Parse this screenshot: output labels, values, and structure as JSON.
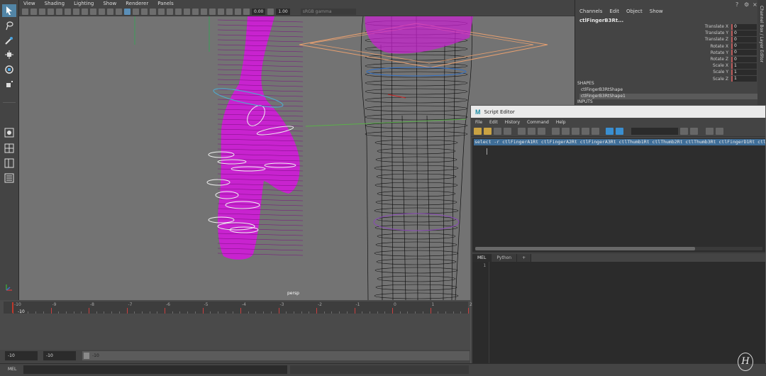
{
  "viewport": {
    "menu": [
      "View",
      "Shading",
      "Lighting",
      "Show",
      "Renderer",
      "Panels"
    ],
    "toolbar": {
      "exposure": "0.00",
      "gamma": "1.00",
      "color_space": "sRGB gamma"
    },
    "camera_label": "persp"
  },
  "channel_box": {
    "menu": [
      "Channels",
      "Edit",
      "Object",
      "Show"
    ],
    "object_name": "ctlFingerB3Rt...",
    "attributes": [
      {
        "label": "Translate X",
        "value": "0"
      },
      {
        "label": "Translate Y",
        "value": "0"
      },
      {
        "label": "Translate Z",
        "value": "0"
      },
      {
        "label": "Rotate X",
        "value": "0"
      },
      {
        "label": "Rotate Y",
        "value": "0"
      },
      {
        "label": "Rotate Z",
        "value": "0"
      },
      {
        "label": "Scale X",
        "value": "1"
      },
      {
        "label": "Scale Y",
        "value": "1"
      },
      {
        "label": "Scale Z",
        "value": "1"
      }
    ],
    "shapes_header": "SHAPES",
    "shapes": [
      "ctlFingerB3RtShape",
      "ctlFingerB3RtShape1"
    ],
    "inputs_header": "INPUTS",
    "side_tab": "Channel Box / Layer Editor"
  },
  "script_editor": {
    "title": "Script Editor",
    "menu": [
      "File",
      "Edit",
      "History",
      "Command",
      "Help"
    ],
    "history_line": "select -r ctlFingerA1Rt ctlFingerA2Rt ctlFingerA3Rt ctlThumb1Rt ctlThumb2Rt ctlThumb3Rt ctlFingerD1Rt ctlFin",
    "tabs": [
      "MEL",
      "Python",
      "+"
    ],
    "line_number": "1"
  },
  "timeline": {
    "ticks": [
      "-10",
      "-9",
      "-8",
      "-7",
      "-6",
      "-5",
      "-4",
      "-3",
      "-2",
      "-1",
      "0",
      "1",
      "2"
    ],
    "current_frame": "-10"
  },
  "range": {
    "start": "-10",
    "anim_start": "-10",
    "slider_value": "-10"
  },
  "command_line": {
    "language": "MEL"
  },
  "colors": {
    "accent": "#5285a6",
    "skin_mesh": "#cc1fd4",
    "selection_highlight": "#3f6e98",
    "maya_logo": "#2fb1c6"
  }
}
